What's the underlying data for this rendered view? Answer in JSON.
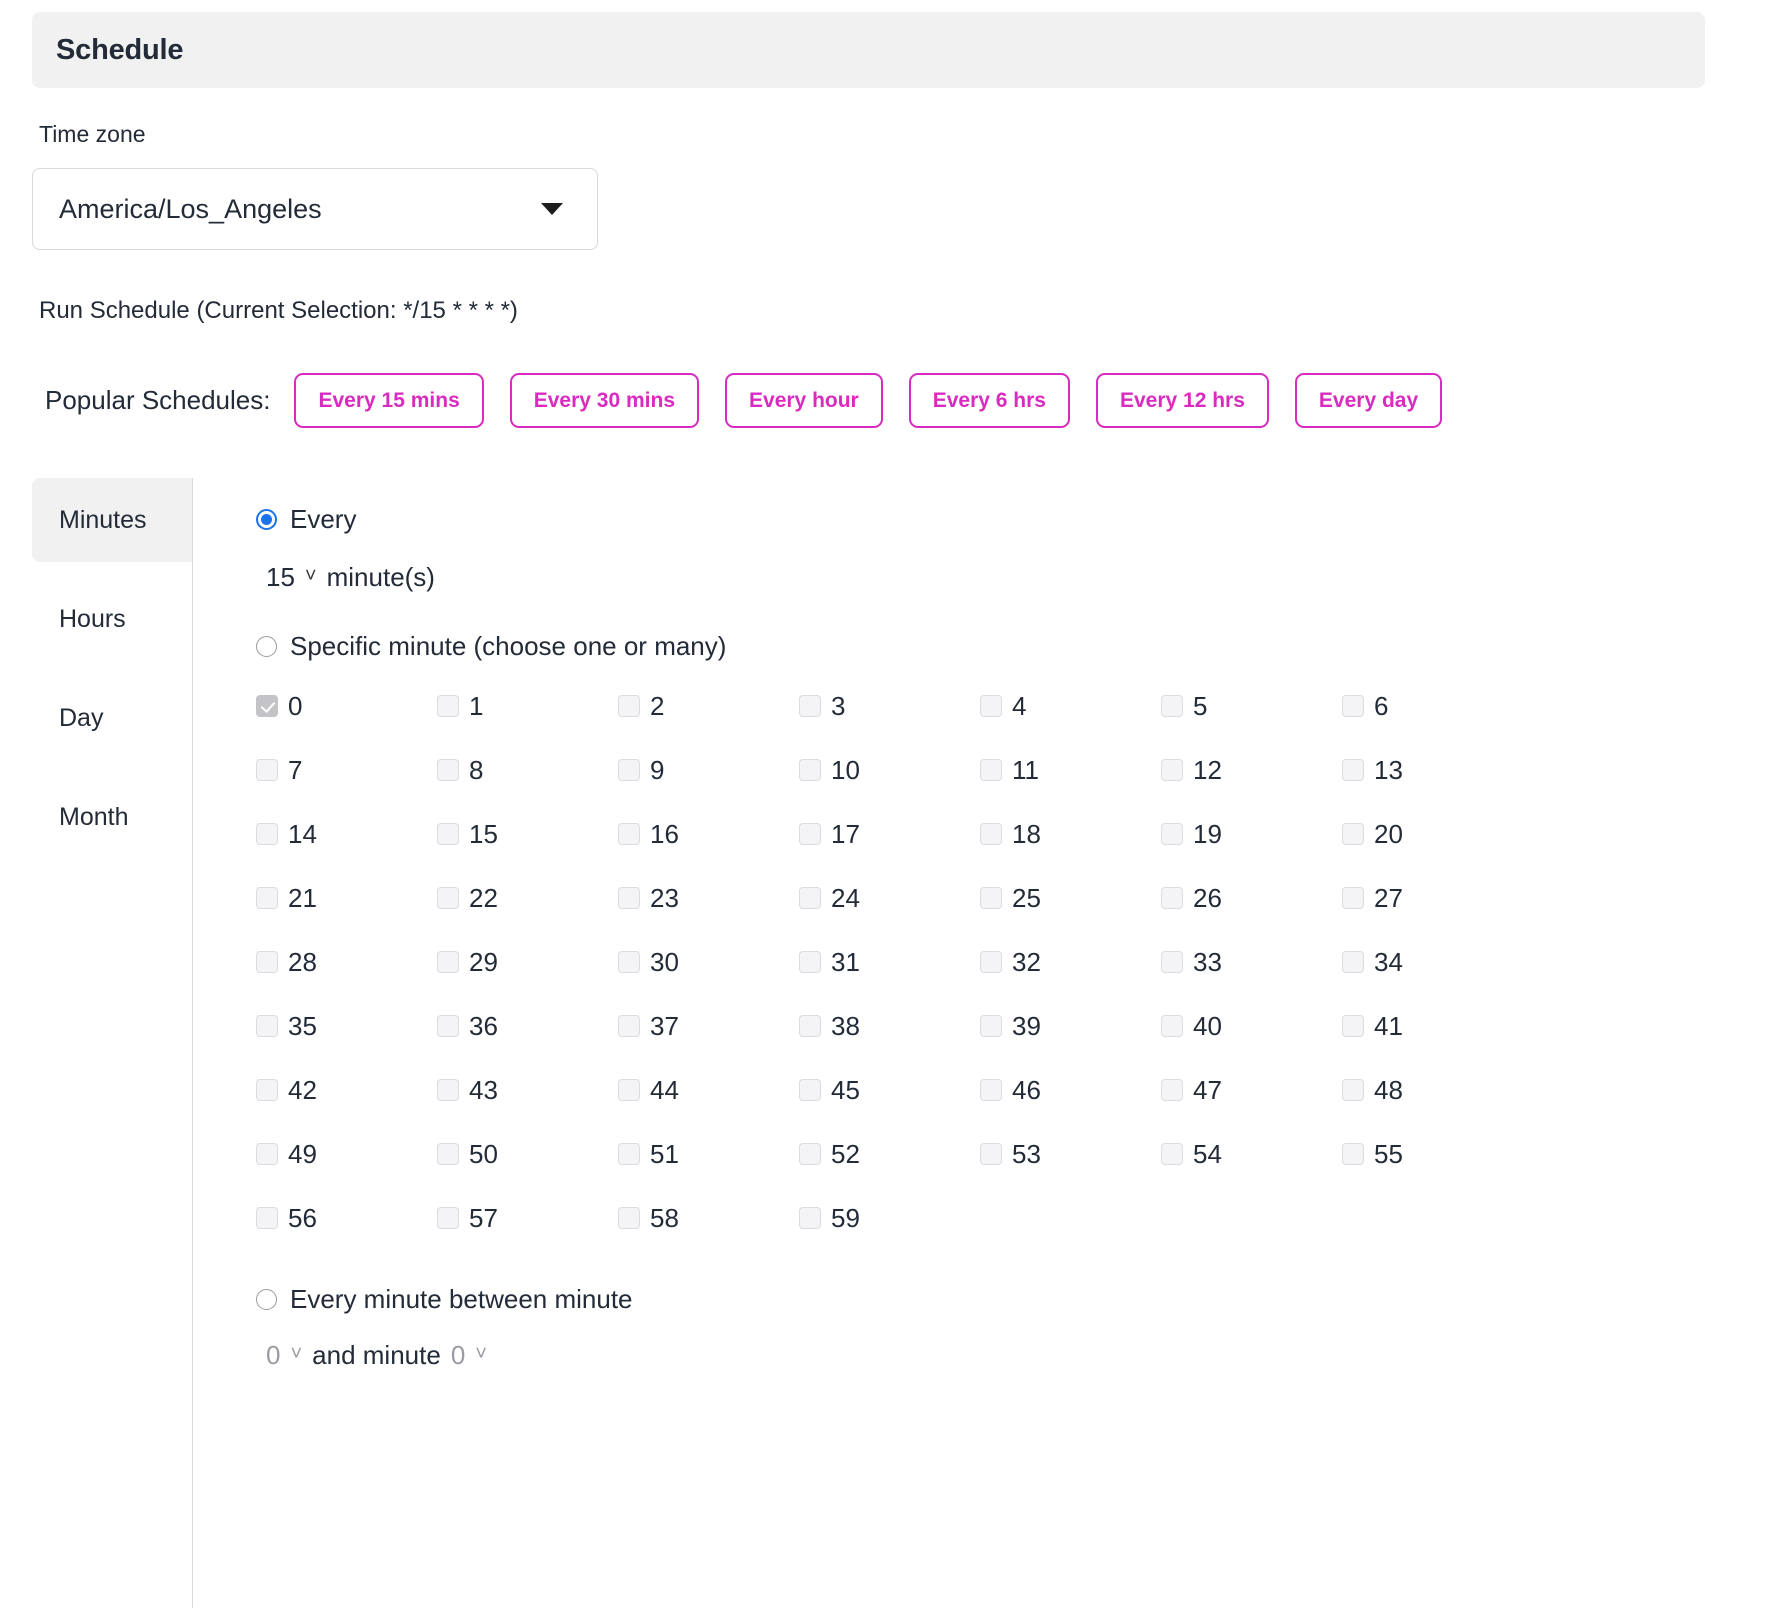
{
  "header": {
    "title": "Schedule"
  },
  "timezone": {
    "label": "Time zone",
    "value": "America/Los_Angeles",
    "caret_icon": "caret-down-icon"
  },
  "run_schedule": {
    "text": "Run Schedule (Current Selection: */15 * * * *)",
    "cron": "*/15 * * * *"
  },
  "popular_schedules": {
    "label": "Popular Schedules:",
    "accent_color": "#d92bc0",
    "items": [
      {
        "label": "Every 15 mins"
      },
      {
        "label": "Every 30 mins"
      },
      {
        "label": "Every hour"
      },
      {
        "label": "Every 6 hrs"
      },
      {
        "label": "Every 12 hrs"
      },
      {
        "label": "Every day"
      }
    ]
  },
  "tabs": [
    {
      "label": "Minutes",
      "active": true
    },
    {
      "label": "Hours",
      "active": false
    },
    {
      "label": "Day",
      "active": false
    },
    {
      "label": "Month",
      "active": false
    }
  ],
  "minutes_panel": {
    "every": {
      "radio_label": "Every",
      "selected": true,
      "interval_value": "15",
      "unit_label": "minute(s)",
      "chevron_icon": "chevron-down-icon"
    },
    "specific": {
      "radio_label": "Specific minute (choose one or many)",
      "selected": false,
      "checked_values": [
        "0"
      ],
      "values": [
        "0",
        "1",
        "2",
        "3",
        "4",
        "5",
        "6",
        "7",
        "8",
        "9",
        "10",
        "11",
        "12",
        "13",
        "14",
        "15",
        "16",
        "17",
        "18",
        "19",
        "20",
        "21",
        "22",
        "23",
        "24",
        "25",
        "26",
        "27",
        "28",
        "29",
        "30",
        "31",
        "32",
        "33",
        "34",
        "35",
        "36",
        "37",
        "38",
        "39",
        "40",
        "41",
        "42",
        "43",
        "44",
        "45",
        "46",
        "47",
        "48",
        "49",
        "50",
        "51",
        "52",
        "53",
        "54",
        "55",
        "56",
        "57",
        "58",
        "59"
      ]
    },
    "between": {
      "radio_label": "Every minute between minute",
      "selected": false,
      "start_value": "0",
      "middle_label": "and minute",
      "end_value": "0",
      "chevron_icon": "chevron-down-icon"
    }
  }
}
